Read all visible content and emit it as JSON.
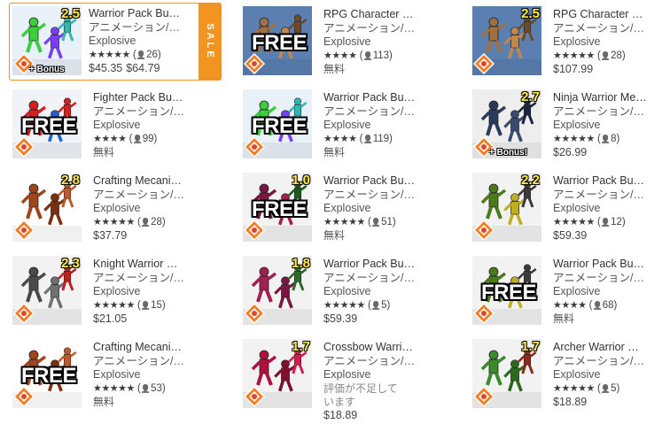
{
  "colors": {
    "sale": "#f29422",
    "badge": "#ffe94a"
  },
  "products": [
    {
      "title": "Warrior Pack Bu…",
      "sub": "アニメーション/…",
      "publisher": "Explosive",
      "stars": "★★★★★",
      "count": "26",
      "price": "$45.35",
      "orig_price": "$64.79",
      "sale": true,
      "sale_label": "SALE",
      "badge": "2.5",
      "free_label": "",
      "bonus": "+ Bonus",
      "icon": "warrior-pack-icon",
      "bg": "#e8f0f8",
      "fig": [
        "#3ccf3c",
        "#7a3cff",
        "#2fb8b0"
      ]
    },
    {
      "title": "RPG Character …",
      "sub": "アニメーション/…",
      "publisher": "Explosive",
      "stars": "★★★★",
      "count": "113",
      "price": "無料",
      "sale": false,
      "badge": "",
      "free_label": "FREE",
      "bonus": "",
      "icon": "rpg-character-icon",
      "bg": "#5a7fb0",
      "fig": [
        "#a07040",
        "#c08850",
        "#6c4a2a"
      ]
    },
    {
      "title": "RPG Character …",
      "sub": "アニメーション/…",
      "publisher": "Explosive",
      "stars": "★★★★★",
      "count": "28",
      "price": "$107.99",
      "sale": false,
      "badge": "2.5",
      "free_label": "",
      "bonus": "",
      "icon": "rpg-character-icon",
      "bg": "#5a7fb0",
      "fig": [
        "#a07040",
        "#c08850",
        "#6c4a2a"
      ]
    },
    {
      "title": "Fighter Pack Bu…",
      "sub": "アニメーション/…",
      "publisher": "Explosive",
      "stars": "★★★★",
      "count": "99",
      "price": "無料",
      "sale": false,
      "badge": "",
      "free_label": "FREE",
      "bonus": "",
      "icon": "fighter-pack-icon",
      "bg": "#f0f4f8",
      "fig": [
        "#d42020",
        "#2060d0",
        "#d42020"
      ]
    },
    {
      "title": "Warrior Pack Bu…",
      "sub": "アニメーション/…",
      "publisher": "Explosive",
      "stars": "★★★★",
      "count": "119",
      "price": "無料",
      "sale": false,
      "badge": "",
      "free_label": "FREE",
      "bonus": "",
      "icon": "warrior-pack-icon",
      "bg": "#e8f0f8",
      "fig": [
        "#3ccf3c",
        "#7a3cff",
        "#2fb8b0"
      ]
    },
    {
      "title": "Ninja Warrior Me…",
      "sub": "アニメーション/…",
      "publisher": "Explosive",
      "stars": "★★★★★",
      "count": "8",
      "price": "$26.99",
      "sale": false,
      "badge": "2.7",
      "free_label": "",
      "bonus": "+ Bonus!",
      "icon": "ninja-warrior-icon",
      "bg": "#eeeeee",
      "fig": [
        "#2a3a5a",
        "#3a4a70",
        "#1a2540"
      ]
    },
    {
      "title": "Crafting Mecani…",
      "sub": "アニメーション/…",
      "publisher": "Explosive",
      "stars": "★★★★★",
      "count": "28",
      "price": "$37.79",
      "sale": false,
      "badge": "2.8",
      "free_label": "",
      "bonus": "",
      "icon": "crafting-mecanim-icon",
      "bg": "#ffffff",
      "fig": [
        "#a0441c",
        "#7a3010",
        "#c05a2a"
      ]
    },
    {
      "title": "Warrior Pack Bu…",
      "sub": "アニメーション/…",
      "publisher": "Explosive",
      "stars": "★★★★★",
      "count": "51",
      "price": "無料",
      "sale": false,
      "badge": "1.0",
      "free_label": "FREE",
      "bonus": "",
      "icon": "warrior-pack-icon",
      "bg": "#f2f2f2",
      "fig": [
        "#7a1840",
        "#a02050",
        "#1a5a1a"
      ]
    },
    {
      "title": "Warrior Pack Bu…",
      "sub": "アニメーション/…",
      "publisher": "Explosive",
      "stars": "★★★★★",
      "count": "12",
      "price": "$59.39",
      "sale": false,
      "badge": "2.2",
      "free_label": "",
      "bonus": "",
      "icon": "warrior-pack-icon",
      "bg": "#f2f2f2",
      "fig": [
        "#4a7a1a",
        "#c0b020",
        "#3a3a3a"
      ]
    },
    {
      "title": "Knight Warrior …",
      "sub": "アニメーション/…",
      "publisher": "Explosive",
      "stars": "★★★★★",
      "count": "15",
      "price": "$21.05",
      "sale": false,
      "badge": "2.3",
      "free_label": "",
      "bonus": "",
      "icon": "knight-warrior-icon",
      "bg": "#f2f2f2",
      "fig": [
        "#4a4a4a",
        "#707070",
        "#c02020"
      ]
    },
    {
      "title": "Warrior Pack Bu…",
      "sub": "アニメーション/…",
      "publisher": "Explosive",
      "stars": "★★★★★",
      "count": "5",
      "price": "$59.39",
      "sale": false,
      "badge": "1.8",
      "free_label": "",
      "bonus": "",
      "icon": "warrior-pack-icon",
      "bg": "#f2f2f2",
      "fig": [
        "#a02050",
        "#7a1840",
        "#2a6a2a"
      ]
    },
    {
      "title": "Warrior Pack Bu…",
      "sub": "アニメーション/…",
      "publisher": "Explosive",
      "stars": "★★★★",
      "count": "68",
      "price": "無料",
      "sale": false,
      "badge": "",
      "free_label": "FREE",
      "bonus": "",
      "icon": "warrior-pack-icon",
      "bg": "#f2f2f2",
      "fig": [
        "#4a7a1a",
        "#c0b020",
        "#3a3a3a"
      ]
    },
    {
      "title": "Crafting Mecani…",
      "sub": "アニメーション/…",
      "publisher": "Explosive",
      "stars": "★★★★★",
      "count": "53",
      "price": "無料",
      "sale": false,
      "badge": "",
      "free_label": "FREE",
      "bonus": "",
      "icon": "crafting-mecanim-icon",
      "bg": "#ffffff",
      "fig": [
        "#a0441c",
        "#7a3010",
        "#c05a2a"
      ]
    },
    {
      "title": "Crossbow Warri…",
      "sub": "アニメーション/…",
      "publisher": "Explosive",
      "stars": "",
      "count": "",
      "no_review": "評価が不足しています",
      "price": "$18.89",
      "sale": false,
      "badge": "1.7",
      "free_label": "",
      "bonus": "",
      "icon": "crossbow-warrior-icon",
      "bg": "#f2f2f2",
      "fig": [
        "#b01040",
        "#801030",
        "#d02050"
      ]
    },
    {
      "title": "Archer Warrior …",
      "sub": "アニメーション/…",
      "publisher": "Explosive",
      "stars": "★★★★★",
      "count": "5",
      "price": "$18.89",
      "sale": false,
      "badge": "1.7",
      "free_label": "",
      "bonus": "",
      "icon": "archer-warrior-icon",
      "bg": "#f2f2f2",
      "fig": [
        "#3a8a2a",
        "#2a6a1a",
        "#8a2a1a"
      ]
    }
  ]
}
